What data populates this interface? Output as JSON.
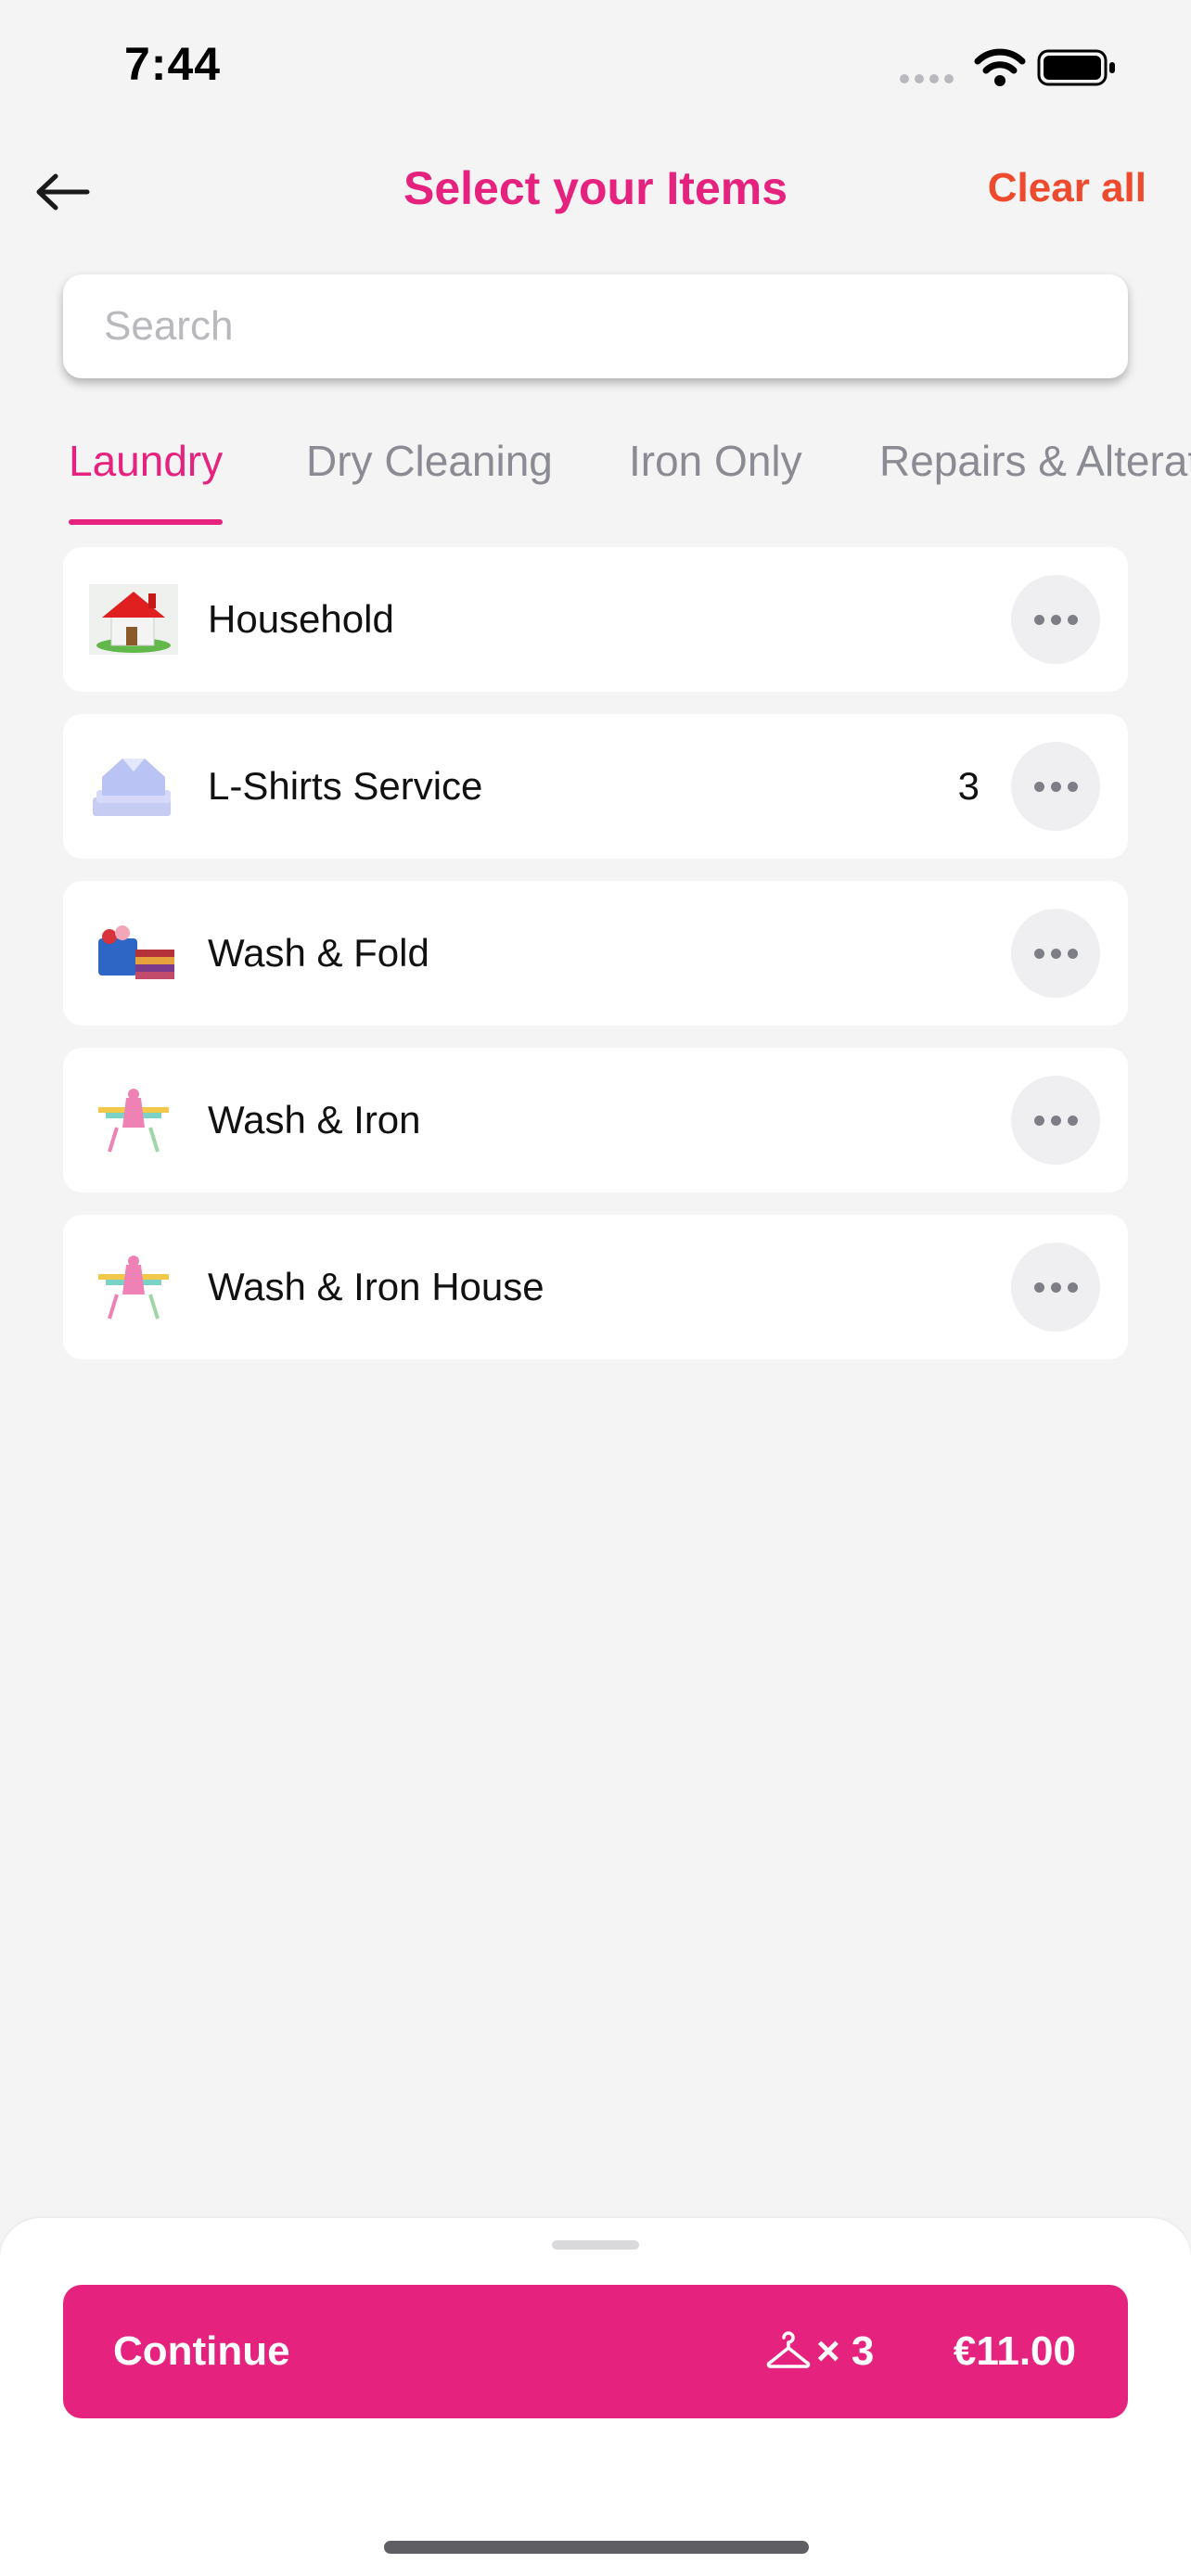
{
  "status_bar": {
    "time": "7:44",
    "icons": [
      "signal-icon",
      "wifi-icon",
      "battery-icon"
    ]
  },
  "header": {
    "back_icon": "arrow-left-icon",
    "title": "Select your Items",
    "clear_all": "Clear all"
  },
  "search": {
    "placeholder": "Search",
    "value": ""
  },
  "tabs": [
    {
      "label": "Laundry",
      "active": true
    },
    {
      "label": "Dry Cleaning",
      "active": false
    },
    {
      "label": "Iron Only",
      "active": false
    },
    {
      "label": "Repairs & Alterat",
      "active": false
    }
  ],
  "items": [
    {
      "label": "Household",
      "count": "",
      "icon": "house-icon"
    },
    {
      "label": "L-Shirts Service",
      "count": "3",
      "icon": "folded-shirt-icon"
    },
    {
      "label": "Wash & Fold",
      "count": "",
      "icon": "laundry-basket-icon"
    },
    {
      "label": "Wash & Iron",
      "count": "",
      "icon": "ironing-icon"
    },
    {
      "label": "Wash & Iron House",
      "count": "",
      "icon": "ironing-icon"
    }
  ],
  "footer": {
    "continue_label": "Continue",
    "count_text": "× 3",
    "price": "€11.00",
    "hanger_icon": "hanger-icon"
  },
  "colors": {
    "accent": "#e5237e",
    "clear_all": "#ee4a2d",
    "background": "#f4f4f5"
  }
}
